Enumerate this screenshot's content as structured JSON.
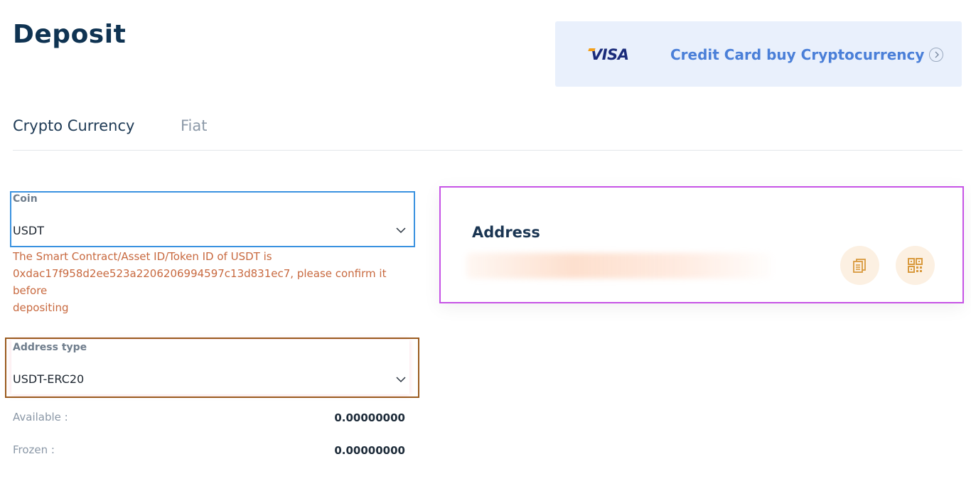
{
  "page": {
    "title": "Deposit"
  },
  "promo": {
    "brand": "VISA",
    "text": "Credit Card buy Cryptocurrency"
  },
  "tabs": [
    {
      "label": "Crypto Currency",
      "active": true
    },
    {
      "label": "Fiat",
      "active": false
    }
  ],
  "coin": {
    "label": "Coin",
    "value": "USDT"
  },
  "warning": {
    "line1": "The Smart Contract/Asset ID/Token ID of USDT is",
    "line2": "0xdac17f958d2ee523a2206206994597c13d831ec7, please confirm it before",
    "line3": "depositing"
  },
  "address_type": {
    "label": "Address type",
    "value": "USDT-ERC20"
  },
  "balances": {
    "available_label": "Available :",
    "available_value": "0.00000000",
    "frozen_label": "Frozen :",
    "frozen_value": "0.00000000"
  },
  "address": {
    "title": "Address"
  },
  "icons": {
    "copy": "copy-icon",
    "qr": "qr-code-icon",
    "arrow": "chevron-right-circle-icon",
    "dropdown": "chevron-down-icon"
  },
  "colors": {
    "title": "#0f3352",
    "promo_bg": "#e9f0fc",
    "promo_text": "#4a7fd8",
    "warning": "#c8693f",
    "icon_accent": "#d99a3e",
    "coin_border": "#3a92e0",
    "address_type_border": "#9a5a1e",
    "address_panel_border": "#c653e6"
  }
}
